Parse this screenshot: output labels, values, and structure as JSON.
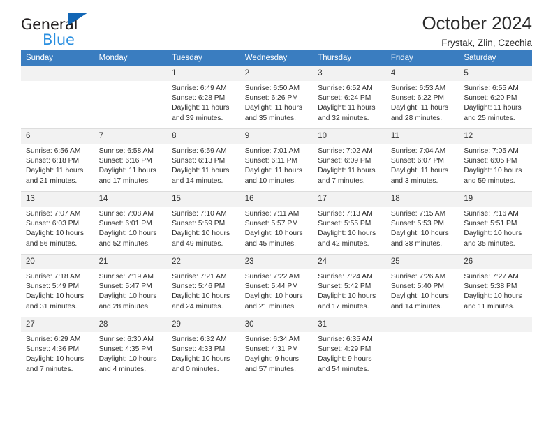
{
  "brand": {
    "name_top": "General",
    "name_bottom": "Blue",
    "triangle_icon": "blue-triangle-icon",
    "color_top": "#231f20",
    "color_bottom": "#2a8fe0",
    "color_triangle": "#1266b5"
  },
  "header": {
    "month_title": "October 2024",
    "location": "Frystak, Zlin, Czechia"
  },
  "theme": {
    "header_row_bg": "#3a7dc0",
    "header_row_text": "#ffffff",
    "daynum_bg": "#f2f2f2",
    "cell_border": "#dddddd"
  },
  "weekday_headers": [
    "Sunday",
    "Monday",
    "Tuesday",
    "Wednesday",
    "Thursday",
    "Friday",
    "Saturday"
  ],
  "weeks": [
    [
      {
        "day": "",
        "sunrise": "",
        "sunset": "",
        "daylight_line1": "",
        "daylight_line2": ""
      },
      {
        "day": "",
        "sunrise": "",
        "sunset": "",
        "daylight_line1": "",
        "daylight_line2": ""
      },
      {
        "day": "1",
        "sunrise": "Sunrise: 6:49 AM",
        "sunset": "Sunset: 6:28 PM",
        "daylight_line1": "Daylight: 11 hours",
        "daylight_line2": "and 39 minutes."
      },
      {
        "day": "2",
        "sunrise": "Sunrise: 6:50 AM",
        "sunset": "Sunset: 6:26 PM",
        "daylight_line1": "Daylight: 11 hours",
        "daylight_line2": "and 35 minutes."
      },
      {
        "day": "3",
        "sunrise": "Sunrise: 6:52 AM",
        "sunset": "Sunset: 6:24 PM",
        "daylight_line1": "Daylight: 11 hours",
        "daylight_line2": "and 32 minutes."
      },
      {
        "day": "4",
        "sunrise": "Sunrise: 6:53 AM",
        "sunset": "Sunset: 6:22 PM",
        "daylight_line1": "Daylight: 11 hours",
        "daylight_line2": "and 28 minutes."
      },
      {
        "day": "5",
        "sunrise": "Sunrise: 6:55 AM",
        "sunset": "Sunset: 6:20 PM",
        "daylight_line1": "Daylight: 11 hours",
        "daylight_line2": "and 25 minutes."
      }
    ],
    [
      {
        "day": "6",
        "sunrise": "Sunrise: 6:56 AM",
        "sunset": "Sunset: 6:18 PM",
        "daylight_line1": "Daylight: 11 hours",
        "daylight_line2": "and 21 minutes."
      },
      {
        "day": "7",
        "sunrise": "Sunrise: 6:58 AM",
        "sunset": "Sunset: 6:16 PM",
        "daylight_line1": "Daylight: 11 hours",
        "daylight_line2": "and 17 minutes."
      },
      {
        "day": "8",
        "sunrise": "Sunrise: 6:59 AM",
        "sunset": "Sunset: 6:13 PM",
        "daylight_line1": "Daylight: 11 hours",
        "daylight_line2": "and 14 minutes."
      },
      {
        "day": "9",
        "sunrise": "Sunrise: 7:01 AM",
        "sunset": "Sunset: 6:11 PM",
        "daylight_line1": "Daylight: 11 hours",
        "daylight_line2": "and 10 minutes."
      },
      {
        "day": "10",
        "sunrise": "Sunrise: 7:02 AM",
        "sunset": "Sunset: 6:09 PM",
        "daylight_line1": "Daylight: 11 hours",
        "daylight_line2": "and 7 minutes."
      },
      {
        "day": "11",
        "sunrise": "Sunrise: 7:04 AM",
        "sunset": "Sunset: 6:07 PM",
        "daylight_line1": "Daylight: 11 hours",
        "daylight_line2": "and 3 minutes."
      },
      {
        "day": "12",
        "sunrise": "Sunrise: 7:05 AM",
        "sunset": "Sunset: 6:05 PM",
        "daylight_line1": "Daylight: 10 hours",
        "daylight_line2": "and 59 minutes."
      }
    ],
    [
      {
        "day": "13",
        "sunrise": "Sunrise: 7:07 AM",
        "sunset": "Sunset: 6:03 PM",
        "daylight_line1": "Daylight: 10 hours",
        "daylight_line2": "and 56 minutes."
      },
      {
        "day": "14",
        "sunrise": "Sunrise: 7:08 AM",
        "sunset": "Sunset: 6:01 PM",
        "daylight_line1": "Daylight: 10 hours",
        "daylight_line2": "and 52 minutes."
      },
      {
        "day": "15",
        "sunrise": "Sunrise: 7:10 AM",
        "sunset": "Sunset: 5:59 PM",
        "daylight_line1": "Daylight: 10 hours",
        "daylight_line2": "and 49 minutes."
      },
      {
        "day": "16",
        "sunrise": "Sunrise: 7:11 AM",
        "sunset": "Sunset: 5:57 PM",
        "daylight_line1": "Daylight: 10 hours",
        "daylight_line2": "and 45 minutes."
      },
      {
        "day": "17",
        "sunrise": "Sunrise: 7:13 AM",
        "sunset": "Sunset: 5:55 PM",
        "daylight_line1": "Daylight: 10 hours",
        "daylight_line2": "and 42 minutes."
      },
      {
        "day": "18",
        "sunrise": "Sunrise: 7:15 AM",
        "sunset": "Sunset: 5:53 PM",
        "daylight_line1": "Daylight: 10 hours",
        "daylight_line2": "and 38 minutes."
      },
      {
        "day": "19",
        "sunrise": "Sunrise: 7:16 AM",
        "sunset": "Sunset: 5:51 PM",
        "daylight_line1": "Daylight: 10 hours",
        "daylight_line2": "and 35 minutes."
      }
    ],
    [
      {
        "day": "20",
        "sunrise": "Sunrise: 7:18 AM",
        "sunset": "Sunset: 5:49 PM",
        "daylight_line1": "Daylight: 10 hours",
        "daylight_line2": "and 31 minutes."
      },
      {
        "day": "21",
        "sunrise": "Sunrise: 7:19 AM",
        "sunset": "Sunset: 5:47 PM",
        "daylight_line1": "Daylight: 10 hours",
        "daylight_line2": "and 28 minutes."
      },
      {
        "day": "22",
        "sunrise": "Sunrise: 7:21 AM",
        "sunset": "Sunset: 5:46 PM",
        "daylight_line1": "Daylight: 10 hours",
        "daylight_line2": "and 24 minutes."
      },
      {
        "day": "23",
        "sunrise": "Sunrise: 7:22 AM",
        "sunset": "Sunset: 5:44 PM",
        "daylight_line1": "Daylight: 10 hours",
        "daylight_line2": "and 21 minutes."
      },
      {
        "day": "24",
        "sunrise": "Sunrise: 7:24 AM",
        "sunset": "Sunset: 5:42 PM",
        "daylight_line1": "Daylight: 10 hours",
        "daylight_line2": "and 17 minutes."
      },
      {
        "day": "25",
        "sunrise": "Sunrise: 7:26 AM",
        "sunset": "Sunset: 5:40 PM",
        "daylight_line1": "Daylight: 10 hours",
        "daylight_line2": "and 14 minutes."
      },
      {
        "day": "26",
        "sunrise": "Sunrise: 7:27 AM",
        "sunset": "Sunset: 5:38 PM",
        "daylight_line1": "Daylight: 10 hours",
        "daylight_line2": "and 11 minutes."
      }
    ],
    [
      {
        "day": "27",
        "sunrise": "Sunrise: 6:29 AM",
        "sunset": "Sunset: 4:36 PM",
        "daylight_line1": "Daylight: 10 hours",
        "daylight_line2": "and 7 minutes."
      },
      {
        "day": "28",
        "sunrise": "Sunrise: 6:30 AM",
        "sunset": "Sunset: 4:35 PM",
        "daylight_line1": "Daylight: 10 hours",
        "daylight_line2": "and 4 minutes."
      },
      {
        "day": "29",
        "sunrise": "Sunrise: 6:32 AM",
        "sunset": "Sunset: 4:33 PM",
        "daylight_line1": "Daylight: 10 hours",
        "daylight_line2": "and 0 minutes."
      },
      {
        "day": "30",
        "sunrise": "Sunrise: 6:34 AM",
        "sunset": "Sunset: 4:31 PM",
        "daylight_line1": "Daylight: 9 hours",
        "daylight_line2": "and 57 minutes."
      },
      {
        "day": "31",
        "sunrise": "Sunrise: 6:35 AM",
        "sunset": "Sunset: 4:29 PM",
        "daylight_line1": "Daylight: 9 hours",
        "daylight_line2": "and 54 minutes."
      },
      {
        "day": "",
        "sunrise": "",
        "sunset": "",
        "daylight_line1": "",
        "daylight_line2": ""
      },
      {
        "day": "",
        "sunrise": "",
        "sunset": "",
        "daylight_line1": "",
        "daylight_line2": ""
      }
    ]
  ]
}
